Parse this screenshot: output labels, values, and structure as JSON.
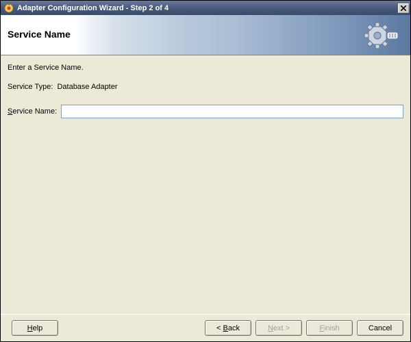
{
  "window": {
    "title": "Adapter Configuration Wizard - Step 2 of 4"
  },
  "header": {
    "title": "Service Name"
  },
  "content": {
    "instruction": "Enter a Service Name.",
    "service_type_label": "Service Type:",
    "service_type_value": "Database Adapter",
    "service_name_label_pre": "S",
    "service_name_label_post": "ervice Name:",
    "service_name_value": ""
  },
  "buttons": {
    "help_pre": "H",
    "help_post": "elp",
    "back_pre": "< ",
    "back_u": "B",
    "back_post": "ack",
    "next_pre": "N",
    "next_post": "ext >",
    "finish_pre": "F",
    "finish_post": "inish",
    "cancel": "Cancel"
  }
}
